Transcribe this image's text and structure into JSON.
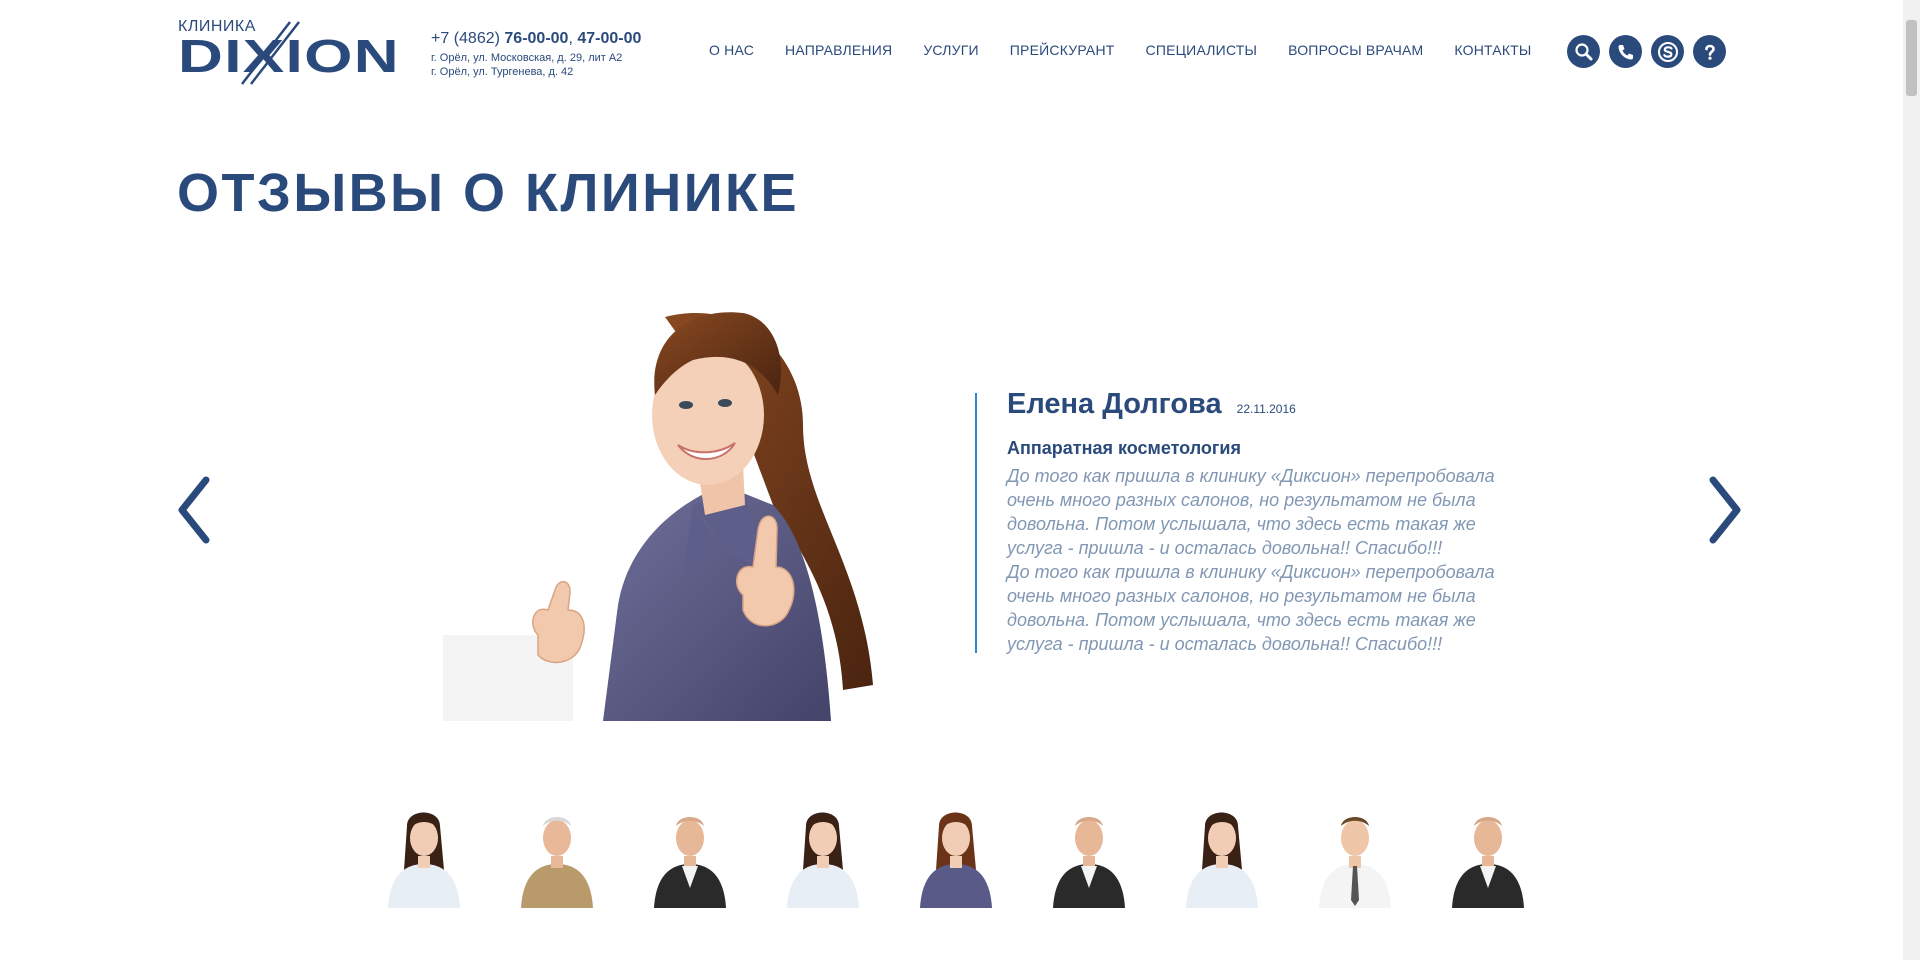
{
  "header": {
    "logo_pre": "КЛИНИКА",
    "logo_name": "DIXION",
    "phone_code": "+7 (4862)",
    "phone_1": "76-00-00",
    "phone_2": "47-00-00",
    "address_1": "г. Орёл, ул. Московская, д. 29, лит А2",
    "address_2": "г. Орёл, ул. Тургенева, д. 42"
  },
  "nav": {
    "items": [
      {
        "label": "О НАС"
      },
      {
        "label": "НАПРАВЛЕНИЯ"
      },
      {
        "label": "УСЛУГИ"
      },
      {
        "label": "ПРЕЙСКУРАНТ"
      },
      {
        "label": "СПЕЦИАЛИСТЫ"
      },
      {
        "label": "ВОПРОСЫ ВРАЧАМ"
      },
      {
        "label": "КОНТАКТЫ"
      }
    ]
  },
  "icons": [
    "search-icon",
    "phone-icon",
    "skype-icon",
    "help-icon"
  ],
  "page": {
    "title": "ОТЗЫВЫ О КЛИНИКЕ"
  },
  "review": {
    "name": "Елена Долгова",
    "date": "22.11.2016",
    "service": "Аппаратная косметология",
    "text_1": "До того как пришла в клинику «Диксион» перепробовала очень много разных салонов, но результатом не была довольна. Потом услышала, что здесь есть такая же услуга - пришла - и осталась довольна!! Спасибо!!!",
    "text_2": "До того как пришла в клинику «Диксион» перепробовала очень много разных салонов, но результатом не была довольна. Потом услышала, что здесь есть такая же услуга - пришла - и осталась довольна!! Спасибо!!!"
  },
  "thumbs": [
    "woman-crossed-arms",
    "elderly-man",
    "man-in-suit",
    "woman-crossed-arms",
    "woman-thumbs-up",
    "man-in-suit",
    "woman-crossed-arms",
    "man-with-tie",
    "man-in-suit"
  ],
  "colors": {
    "brand": "#2b4a7c",
    "accent_line": "#2f86d6",
    "review_text": "#8197b3"
  }
}
